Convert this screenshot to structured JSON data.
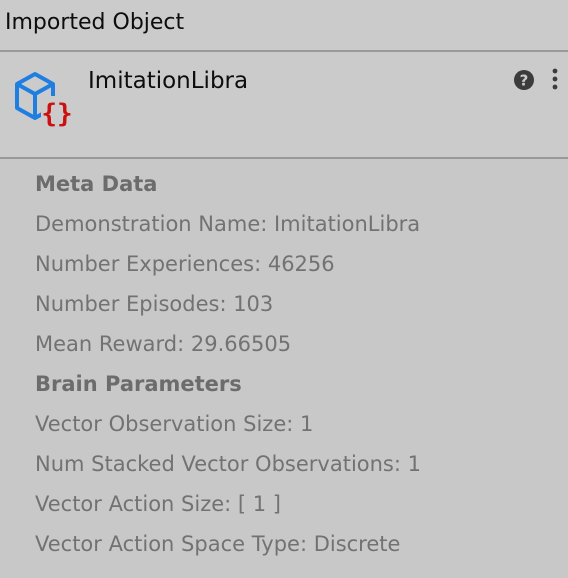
{
  "window": {
    "title": "Imported Object"
  },
  "object": {
    "name": "ImitationLibra",
    "icon": "demonstration-asset-icon",
    "help_icon": "help-icon",
    "menu_icon": "more-vertical-icon"
  },
  "meta_data": {
    "heading": "Meta Data",
    "demonstration_name": "Demonstration Name: ImitationLibra",
    "number_experiences": "Number Experiences: 46256",
    "number_episodes": "Number Episodes: 103",
    "mean_reward": "Mean Reward: 29.66505"
  },
  "brain_parameters": {
    "heading": "Brain Parameters",
    "vector_observation_size": "Vector Observation Size: 1",
    "num_stacked_vector_observations": "Num Stacked Vector Observations: 1",
    "vector_action_size": "Vector Action Size: [ 1 ]",
    "vector_action_space_type": "Vector Action Space Type: Discrete"
  },
  "colors": {
    "background": "#c8c8c8",
    "header_background": "#cbcbcb",
    "divider": "#999999",
    "icon_blue": "#1f7fe0",
    "icon_red": "#cc1010",
    "label_text": "#727272"
  }
}
